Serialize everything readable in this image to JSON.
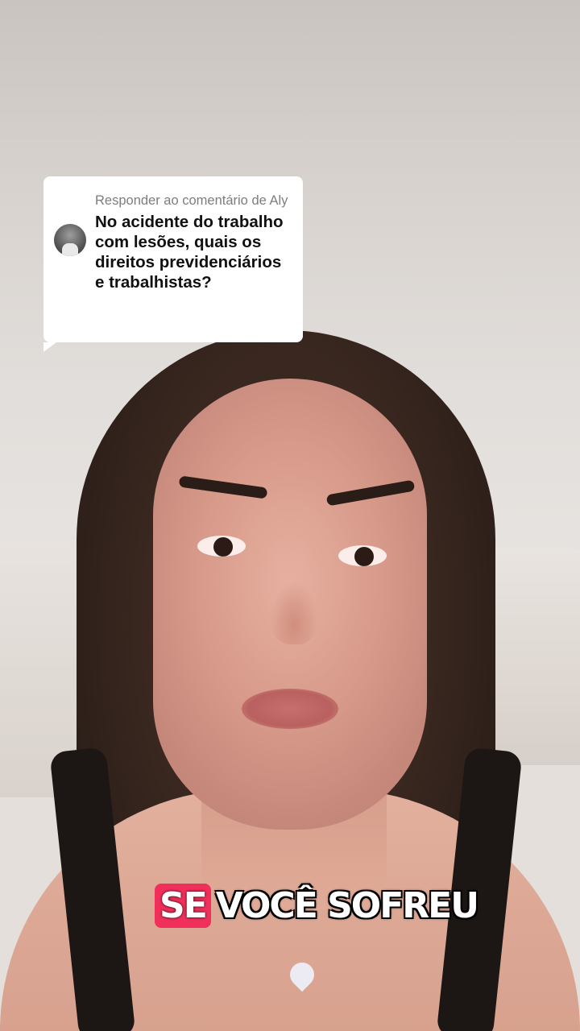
{
  "comment_reply": {
    "header": "Responder ao comentário de Aly",
    "text": "No acidente do trabalho com lesões, quais os direitos previdenciários e trabalhistas?"
  },
  "caption": {
    "highlight": "SE",
    "rest": "VOCÊ SOFREU",
    "highlight_color": "#f0305b"
  }
}
